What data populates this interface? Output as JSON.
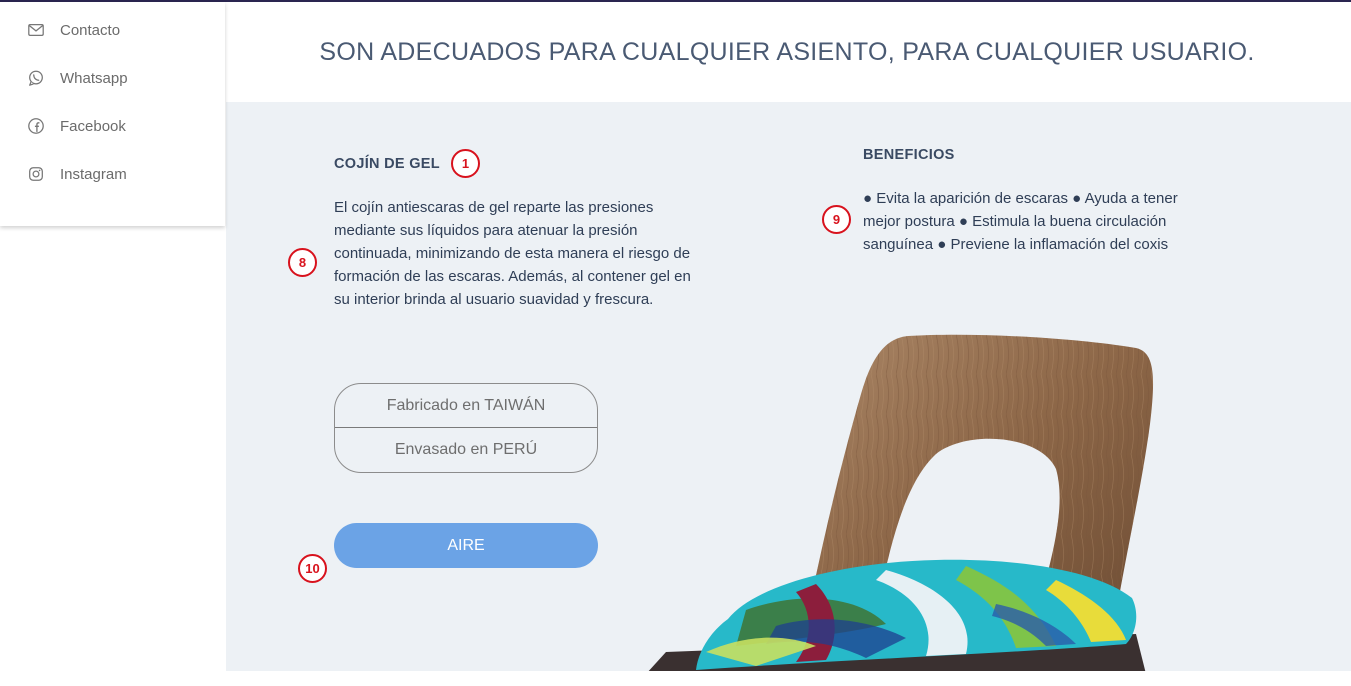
{
  "sidebar": {
    "items": [
      {
        "label": "Contacto",
        "icon": "mail-icon"
      },
      {
        "label": "Whatsapp",
        "icon": "whatsapp-icon"
      },
      {
        "label": "Facebook",
        "icon": "facebook-icon"
      },
      {
        "label": "Instagram",
        "icon": "instagram-icon"
      }
    ]
  },
  "header": {
    "title": "SON ADECUADOS PARA CUALQUIER ASIENTO, PARA CUALQUIER USUARIO."
  },
  "product": {
    "title": "COJÍN DE GEL",
    "description": "El cojín antiescaras de gel reparte las presiones mediante sus líquidos para atenuar la presión continuada, minimizando de esta manera el riesgo de formación de las escaras. Además, al contener gel en su interior brinda al usuario suavidad y frescura.",
    "origin": {
      "made_in": "Fabricado en TAIWÁN",
      "packed_in": "Envasado en PERÚ"
    },
    "button_label": "AIRE"
  },
  "benefits": {
    "title": "BENEFICIOS",
    "text": "● Evita la aparición de escaras ● Ayuda a tener mejor postura ● Estimula la buena circulación sanguínea ● Previene la inflamación del coxis"
  },
  "markers": {
    "m1": "1",
    "m8": "8",
    "m9": "9",
    "m10": "10"
  },
  "colors": {
    "accent": "#6ba3e6",
    "marker": "#d8121d",
    "panel_bg": "#edf1f5",
    "heading": "#4a5a73"
  }
}
